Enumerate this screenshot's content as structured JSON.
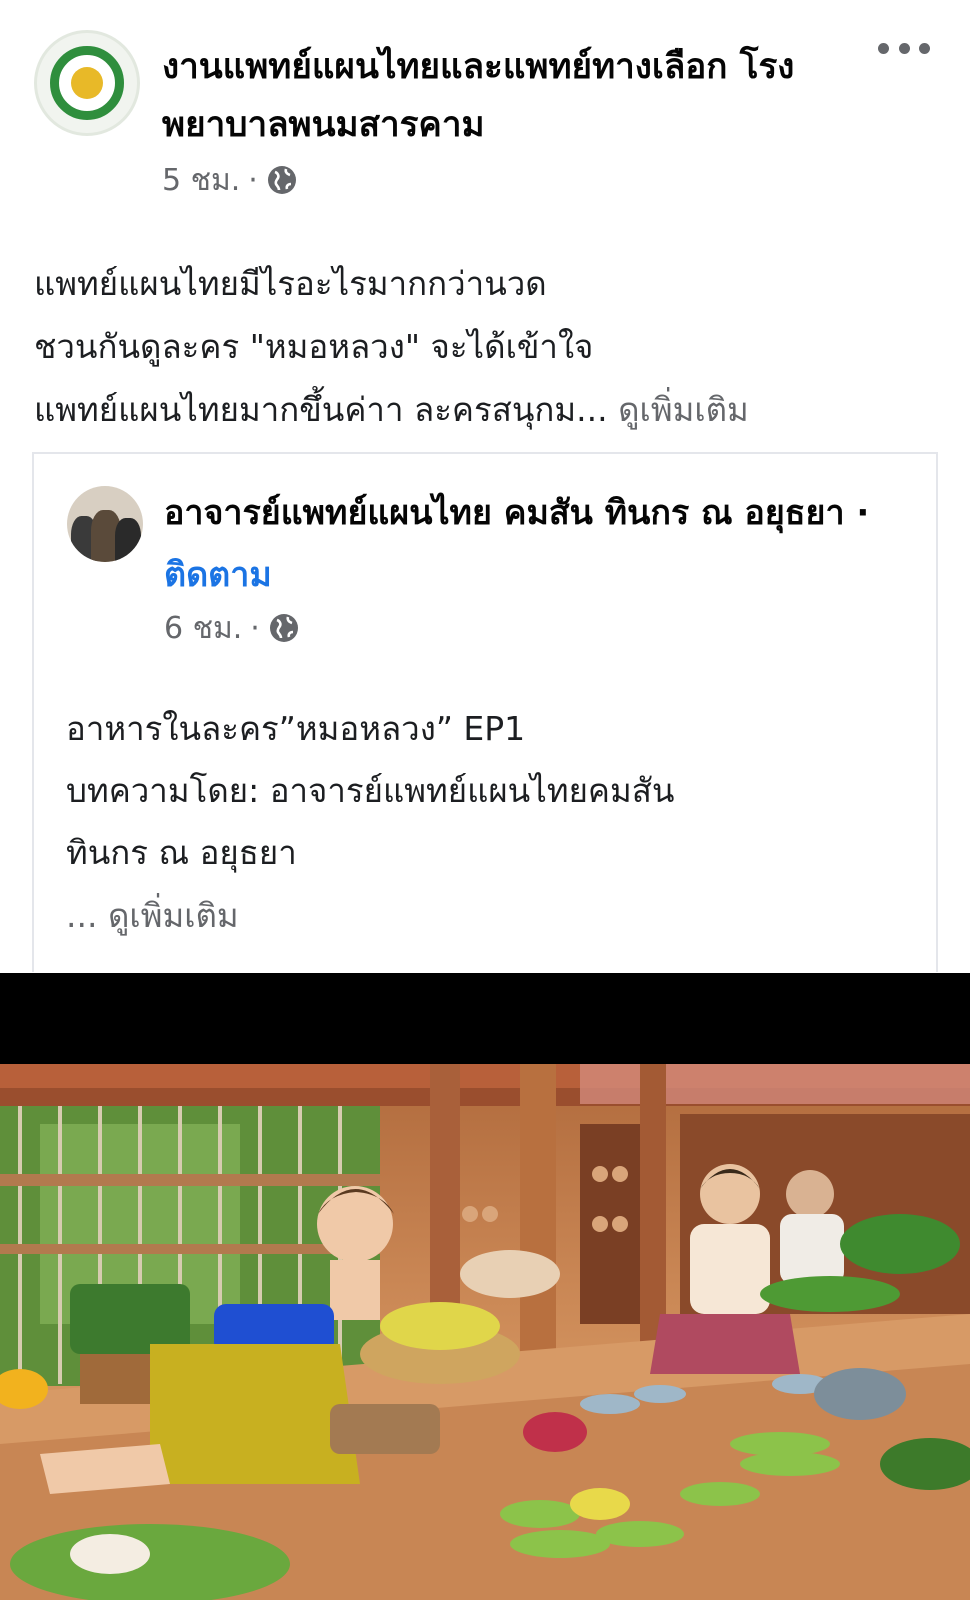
{
  "post": {
    "page_name": "งานแพทย์แผนไทยและแพทย์ทางเลือก โรงพยาบาลพนมสารคาม",
    "time": "5 ชม.",
    "dot": "·",
    "text_lines": [
      "แพทย์แผนไทยมีไรอะไรมากกว่านวด",
      "ชวนกันดูละคร \"หมอหลวง\" จะได้เข้าใจ",
      "แพทย์แผนไทยมากขึ้นค่าา ละครสนุกม..."
    ],
    "see_more": "ดูเพิ่มเติม"
  },
  "shared": {
    "author_name": "อาจารย์แพทย์แผนไทย คมสัน ทินกร ณ อยุธยา",
    "separator": "·",
    "follow": "ติดตาม",
    "time": "6 ชม.",
    "dot": "·",
    "text_lines": [
      "อาหารในละคร”หมอหลวง” EP1",
      "บทความโดย: อาจารย์แพทย์แผนไทยคมสัน",
      "ทินกร ณ อยุธยา"
    ],
    "ellipsis": "...",
    "see_more": "ดูเพิ่มเติม"
  },
  "colors": {
    "link_blue": "#1b74e4",
    "meta_gray": "#65676b",
    "logo_green": "#2f8e3d"
  },
  "icons": [
    "more-icon",
    "globe-icon"
  ]
}
